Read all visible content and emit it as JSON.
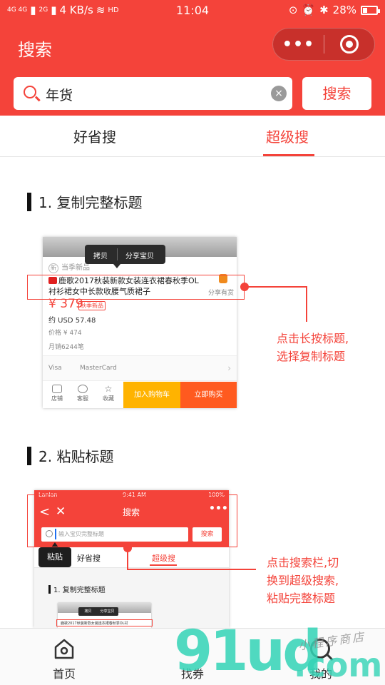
{
  "status_bar": {
    "network": "4G 4G",
    "network2": "2G",
    "speed": "4 KB/s",
    "hd": "HD",
    "time": "11:04",
    "battery": "28%"
  },
  "header": {
    "title": "搜索",
    "more_label": "•••"
  },
  "search": {
    "query": "年货",
    "clear_label": "×",
    "button_label": "搜索"
  },
  "tabs": [
    {
      "label": "好省搜"
    },
    {
      "label": "超级搜"
    }
  ],
  "steps": {
    "step1": "1. 复制完整标题",
    "step2": "2. 粘贴标题"
  },
  "illustration1": {
    "popup_copy": "拷贝",
    "popup_share": "分享宝贝",
    "new_tag": "当季新品",
    "new_tag_icon": "新",
    "product_title": "鹿歌2017秋装新款女装连衣裙春秋季OL衬衫裙女中长款收腰气质裙子",
    "share_reward": "分享有赏",
    "price": "¥ 379",
    "price_tag": "秋季新品",
    "usd": "约 USD 57.48",
    "original_price": "价格 ¥ 474",
    "monthly_sales": "月销6244笔",
    "pay1": "Visa",
    "pay2": "MasterCard",
    "nav_shop": "店铺",
    "nav_service": "客服",
    "nav_fav": "收藏",
    "add_cart": "加入购物车",
    "buy_now": "立即购买",
    "annotation_line1": "点击长按标题,",
    "annotation_line2": "选择复制标题"
  },
  "illustration2": {
    "carrier": "Lanlan",
    "time": "9:41 AM",
    "battery": "100%",
    "title": "搜索",
    "more": "•••",
    "placeholder": "输入宝贝完整标题",
    "search_button": "搜索",
    "tab1": "好省搜",
    "tab2": "超级搜",
    "step": "1. 复制完整标题",
    "mini_copy": "拷贝",
    "mini_share": "分享宝贝",
    "mini_title": "鹿歌2017秋装新款女装连衣裙春秋季OL衬",
    "paste_label": "粘贴",
    "annotation_line1": "点击搜索栏,切",
    "annotation_line2": "换到超级搜索,",
    "annotation_line3": "粘贴完整标题"
  },
  "bottom_nav": [
    {
      "label": "首页",
      "icon": "home-icon"
    },
    {
      "label": "找券",
      "icon": "search-icon"
    },
    {
      "label": "我的",
      "icon": "user-icon"
    }
  ],
  "watermark": {
    "brand": "91ud",
    "domain": ".com",
    "tagline": "小程序商店"
  },
  "colors": {
    "accent": "#f4433a",
    "watermark": "#33d4b6"
  }
}
